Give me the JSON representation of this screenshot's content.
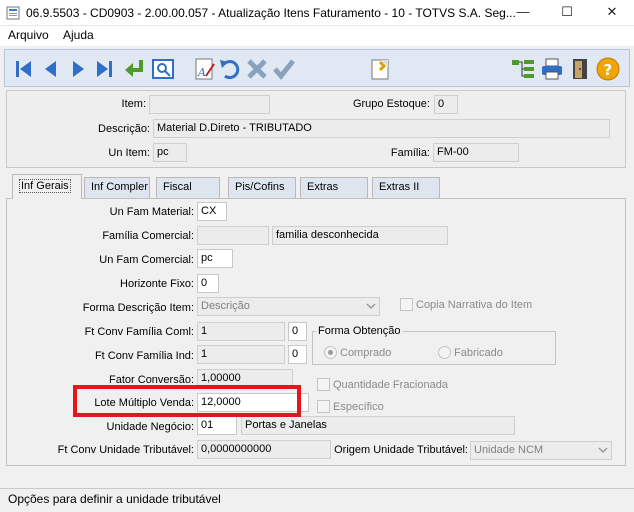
{
  "window": {
    "title": "06.9.5503 - CD0903 - 2.00.00.057 - Atualização Itens Faturamento - 10 - TOTVS S.A. Seg...",
    "minimize_glyph": "—",
    "maximize_glyph": "☐",
    "close_glyph": "✕"
  },
  "menu": {
    "arquivo": "Arquivo",
    "ajuda": "Ajuda"
  },
  "header": {
    "item_label": "Item:",
    "item_value": "",
    "grupo_estoque_label": "Grupo Estoque:",
    "grupo_estoque_value": "0",
    "descricao_label": "Descrição:",
    "descricao_value": "Material D.Direto - TRIBUTADO",
    "un_item_label": "Un Item:",
    "un_item_value": "pc",
    "familia_label": "Família:",
    "familia_value": "FM-00"
  },
  "tabs": [
    "Inf Gerais",
    "Inf Compler",
    "Fiscal",
    "Pis/Cofins",
    "Extras",
    "Extras II"
  ],
  "form": {
    "un_fam_material_label": "Un Fam Material:",
    "un_fam_material_value": "CX",
    "familia_comercial_label": "Família Comercial:",
    "familia_comercial_code": "",
    "familia_comercial_desc": "familia desconhecida",
    "un_fam_comercial_label": "Un Fam Comercial:",
    "un_fam_comercial_value": "pc",
    "horizonte_fixo_label": "Horizonte Fixo:",
    "horizonte_fixo_value": "0",
    "forma_descricao_label": "Forma Descrição Item:",
    "forma_descricao_value": "Descrição",
    "copia_narrativa_label": "Copia Narrativa do Item",
    "ft_conv_fam_coml_label": "Ft Conv Família Coml:",
    "ft_conv_fam_coml_value": "1",
    "ft_conv_fam_coml_dec": "0",
    "ft_conv_fam_ind_label": "Ft Conv Família Ind:",
    "ft_conv_fam_ind_value": "1",
    "ft_conv_fam_ind_dec": "0",
    "forma_obtencao_label": "Forma Obtenção",
    "comprado_label": "Comprado",
    "fabricado_label": "Fabricado",
    "fator_conversao_label": "Fator Conversão:",
    "fator_conversao_value": "1,00000",
    "qtd_fracionada_label": "Quantidade Fracionada",
    "lote_multiplo_label": "Lote Múltiplo Venda:",
    "lote_multiplo_value": "12,0000",
    "especifico_label": "Específico",
    "unidade_negocio_label": "Unidade Negócio:",
    "unidade_negocio_code": "01",
    "unidade_negocio_desc": "Portas e Janelas",
    "ft_conv_un_trib_label": "Ft Conv Unidade Tributável:",
    "ft_conv_un_trib_value": "0,0000000000",
    "origem_un_trib_label": "Origem Unidade Tributável:",
    "origem_un_trib_value": "Unidade NCM"
  },
  "status": {
    "text": "Opções para definir a unidade tributável"
  },
  "colors": {
    "highlight": "#e8141b",
    "toolbar_bg": "#dfe8f3",
    "icon_blue": "#2f6fc9"
  },
  "toolbar_icons": [
    "first-icon",
    "previous-icon",
    "next-icon",
    "last-icon",
    "goto-icon",
    "search-icon",
    "edit-icon",
    "undo-icon",
    "delete-icon",
    "confirm-icon",
    "list-icon",
    "hierarchy-icon",
    "print-icon",
    "exit-icon",
    "help-icon"
  ]
}
